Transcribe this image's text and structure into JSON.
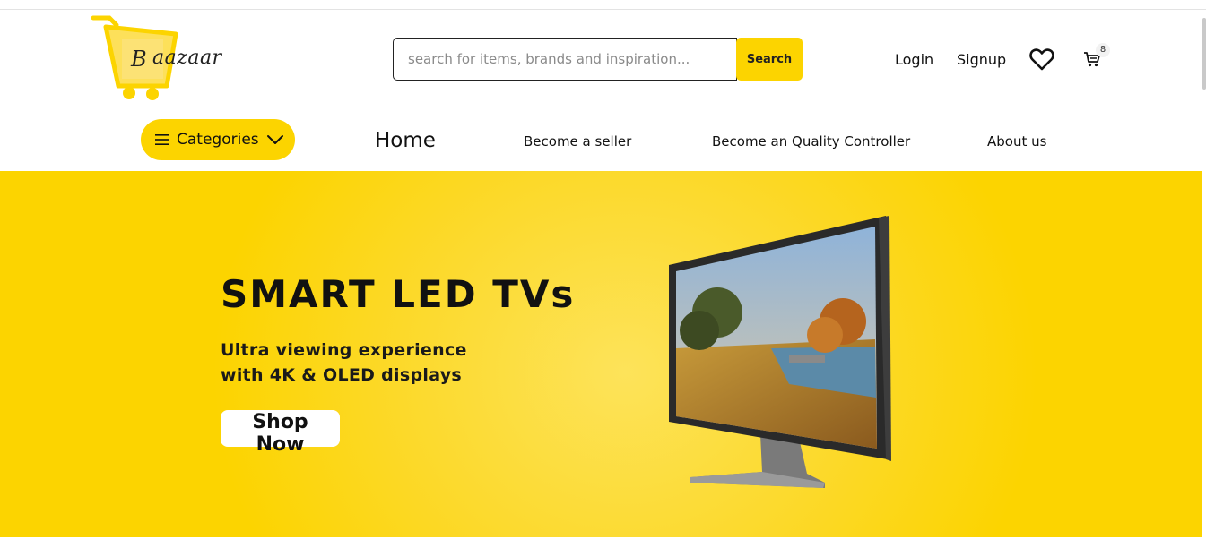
{
  "header": {
    "logo_text": "aazaar",
    "logo_letter": "B",
    "search_placeholder": "search for items, brands and inspiration...",
    "search_button": "Search",
    "login": "Login",
    "signup": "Signup",
    "cart_count": "8",
    "icons": [
      "heart-icon",
      "cart-icon"
    ]
  },
  "nav": {
    "categories": "Categories",
    "links": [
      "Home",
      "Become a seller",
      "Become an Quality Controller",
      "About us"
    ]
  },
  "banner": {
    "title": "SMART LED TVs",
    "subtitle": "Ultra viewing experience with 4K & OLED displays",
    "cta": "Shop Now"
  },
  "colors": {
    "accent": "#fcd400",
    "text": "#111111"
  }
}
